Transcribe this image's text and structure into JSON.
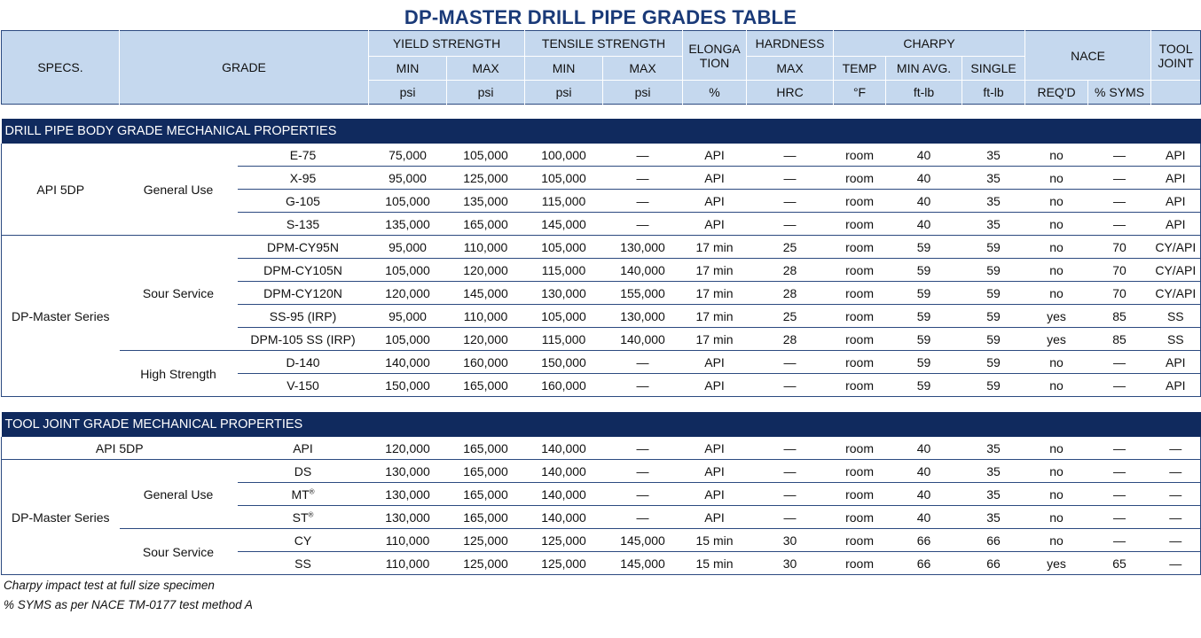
{
  "title": "DP-MASTER DRILL PIPE GRADES TABLE",
  "header": {
    "specs": "SPECS.",
    "grade": "GRADE",
    "yield": "YIELD STRENGTH",
    "tensile": "TENSILE STRENGTH",
    "elong": "ELONGA TION",
    "hardness": "HARDNESS",
    "charpy": "CHARPY",
    "nace": "NACE",
    "tooljoint": "TOOL JOINT",
    "min": "MIN",
    "max": "MAX",
    "temp": "TEMP",
    "min_avg": "MIN AVG.",
    "single": "SINGLE",
    "psi": "psi",
    "pct": "%",
    "hrc": "HRC",
    "degf": "°F",
    "ftlb": "ft-lb",
    "reqd": "REQ'D",
    "syms": "% SYMS"
  },
  "body_section": {
    "title": "DRILL PIPE BODY GRADE MECHANICAL PROPERTIES",
    "groups": [
      {
        "spec": "API 5DP",
        "use": "General Use"
      },
      {
        "spec": "DP-Master Series",
        "use_sour": "Sour Service",
        "use_high": "High Strength"
      }
    ],
    "rows": [
      [
        "E-75",
        "75,000",
        "105,000",
        "100,000",
        "—",
        "API",
        "—",
        "room",
        "40",
        "35",
        "no",
        "—",
        "API"
      ],
      [
        "X-95",
        "95,000",
        "125,000",
        "105,000",
        "—",
        "API",
        "—",
        "room",
        "40",
        "35",
        "no",
        "—",
        "API"
      ],
      [
        "G-105",
        "105,000",
        "135,000",
        "115,000",
        "—",
        "API",
        "—",
        "room",
        "40",
        "35",
        "no",
        "—",
        "API"
      ],
      [
        "S-135",
        "135,000",
        "165,000",
        "145,000",
        "—",
        "API",
        "—",
        "room",
        "40",
        "35",
        "no",
        "—",
        "API"
      ],
      [
        "DPM-CY95N",
        "95,000",
        "110,000",
        "105,000",
        "130,000",
        "17 min",
        "25",
        "room",
        "59",
        "59",
        "no",
        "70",
        "CY/API"
      ],
      [
        "DPM-CY105N",
        "105,000",
        "120,000",
        "115,000",
        "140,000",
        "17 min",
        "28",
        "room",
        "59",
        "59",
        "no",
        "70",
        "CY/API"
      ],
      [
        "DPM-CY120N",
        "120,000",
        "145,000",
        "130,000",
        "155,000",
        "17 min",
        "28",
        "room",
        "59",
        "59",
        "no",
        "70",
        "CY/API"
      ],
      [
        "SS-95 (IRP)",
        "95,000",
        "110,000",
        "105,000",
        "130,000",
        "17 min",
        "25",
        "room",
        "59",
        "59",
        "yes",
        "85",
        "SS"
      ],
      [
        "DPM-105 SS (IRP)",
        "105,000",
        "120,000",
        "115,000",
        "140,000",
        "17 min",
        "28",
        "room",
        "59",
        "59",
        "yes",
        "85",
        "SS"
      ],
      [
        "D-140",
        "140,000",
        "160,000",
        "150,000",
        "—",
        "API",
        "—",
        "room",
        "59",
        "59",
        "no",
        "—",
        "API"
      ],
      [
        "V-150",
        "150,000",
        "165,000",
        "160,000",
        "—",
        "API",
        "—",
        "room",
        "59",
        "59",
        "no",
        "—",
        "API"
      ]
    ]
  },
  "joint_section": {
    "title": "TOOL JOINT GRADE MECHANICAL PROPERTIES",
    "spec_api": "API 5DP",
    "spec_dpm": "DP-Master Series",
    "use_general": "General Use",
    "use_sour": "Sour Service",
    "registered": "®",
    "rows": [
      [
        "API",
        "120,000",
        "165,000",
        "140,000",
        "—",
        "API",
        "—",
        "room",
        "40",
        "35",
        "no",
        "—",
        "—"
      ],
      [
        "DS",
        "130,000",
        "165,000",
        "140,000",
        "—",
        "API",
        "—",
        "room",
        "40",
        "35",
        "no",
        "—",
        "—"
      ],
      [
        "MT",
        "130,000",
        "165,000",
        "140,000",
        "—",
        "API",
        "—",
        "room",
        "40",
        "35",
        "no",
        "—",
        "—"
      ],
      [
        "ST",
        "130,000",
        "165,000",
        "140,000",
        "—",
        "API",
        "—",
        "room",
        "40",
        "35",
        "no",
        "—",
        "—"
      ],
      [
        "CY",
        "110,000",
        "125,000",
        "125,000",
        "145,000",
        "15 min",
        "30",
        "room",
        "66",
        "66",
        "no",
        "—",
        "—"
      ],
      [
        "SS",
        "110,000",
        "125,000",
        "125,000",
        "145,000",
        "15 min",
        "30",
        "room",
        "66",
        "66",
        "yes",
        "65",
        "—"
      ]
    ]
  },
  "notes": [
    "Charpy impact test at full size specimen",
    "% SYMS as per NACE TM-0177 test method A"
  ]
}
